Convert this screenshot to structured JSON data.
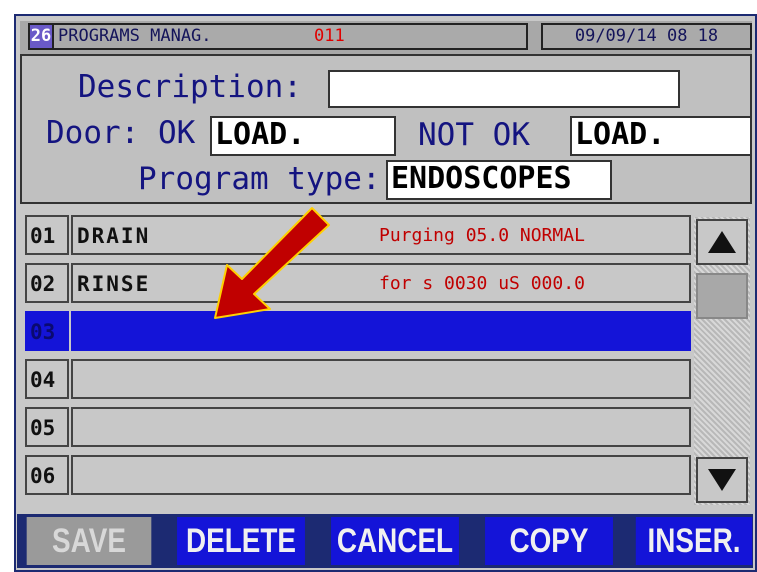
{
  "titlebar": {
    "number": "26",
    "title": "PROGRAMS MANAG.",
    "code": "011",
    "datetime": "09/09/14  08 18"
  },
  "header": {
    "description_label": "Description:",
    "description_value": "",
    "door_label": "Door: OK",
    "door_ok_value": "LOAD.",
    "not_ok_label": "NOT OK",
    "door_not_ok_value": "LOAD.",
    "program_type_label": "Program type:",
    "program_type_value": "ENDOSCOPES"
  },
  "steps": [
    {
      "num": "01",
      "name": "DRAIN",
      "info": "Purging   05.0  NORMAL"
    },
    {
      "num": "02",
      "name": "RINSE",
      "info": "for s 0030  uS 000.0"
    },
    {
      "num": "03",
      "name": "",
      "info": ""
    },
    {
      "num": "04",
      "name": "",
      "info": ""
    },
    {
      "num": "05",
      "name": "",
      "info": ""
    },
    {
      "num": "06",
      "name": "",
      "info": ""
    }
  ],
  "selected_step": "03",
  "scroll": {
    "up_icon": "triangle-up-icon",
    "down_icon": "triangle-down-icon"
  },
  "buttons": {
    "save": "SAVE",
    "delete": "DELETE",
    "cancel": "CANCEL",
    "copy": "COPY",
    "insert": "INSER."
  },
  "colors": {
    "selection": "#1414d8",
    "accent_red": "#c00000",
    "arrow": "#c00000",
    "panel": "#c8c8c8"
  }
}
